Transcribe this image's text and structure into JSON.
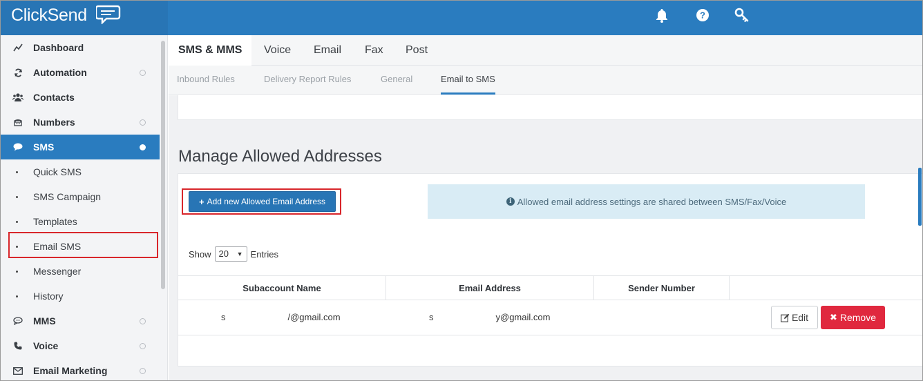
{
  "app": {
    "logo_text": "ClickSend",
    "brand_color": "#2a7cbf",
    "top_icons": [
      "bell-icon",
      "help-icon",
      "key-icon"
    ]
  },
  "sidebar": {
    "items": [
      {
        "label": "Dashboard",
        "icon": "chart-line-icon"
      },
      {
        "label": "Automation",
        "icon": "refresh-icon"
      },
      {
        "label": "Contacts",
        "icon": "users-icon"
      },
      {
        "label": "Numbers",
        "icon": "phone-desk-icon"
      },
      {
        "label": "SMS",
        "icon": "chat-bubble-icon"
      },
      {
        "label": "MMS",
        "icon": "chat-outline-icon"
      },
      {
        "label": "Voice",
        "icon": "phone-icon"
      },
      {
        "label": "Email Marketing",
        "icon": "envelope-icon"
      }
    ],
    "sms_sub_items": [
      "Quick SMS",
      "SMS Campaign",
      "Templates",
      "Email SMS",
      "Messenger",
      "History"
    ]
  },
  "main_tabs": [
    "SMS & MMS",
    "Voice",
    "Email",
    "Fax",
    "Post"
  ],
  "sub_tabs": [
    "Inbound Rules",
    "Delivery Report Rules",
    "General",
    "Email to SMS"
  ],
  "section": {
    "title": "Manage Allowed Addresses",
    "add_button": "Add new Allowed Email Address",
    "info_text": "Allowed email address settings are shared between SMS/Fax/Voice"
  },
  "entries": {
    "show_label": "Show",
    "selected": "20",
    "entries_label": "Entries"
  },
  "table": {
    "headers": [
      "Subaccount Name",
      "Email Address",
      "Sender Number"
    ],
    "rows": [
      {
        "subaccount_prefix": "s",
        "subaccount_suffix": "/@gmail.com",
        "email_prefix": "s",
        "email_suffix": "y@gmail.com",
        "sender_number": "",
        "edit_label": "Edit",
        "remove_label": "Remove"
      }
    ]
  }
}
